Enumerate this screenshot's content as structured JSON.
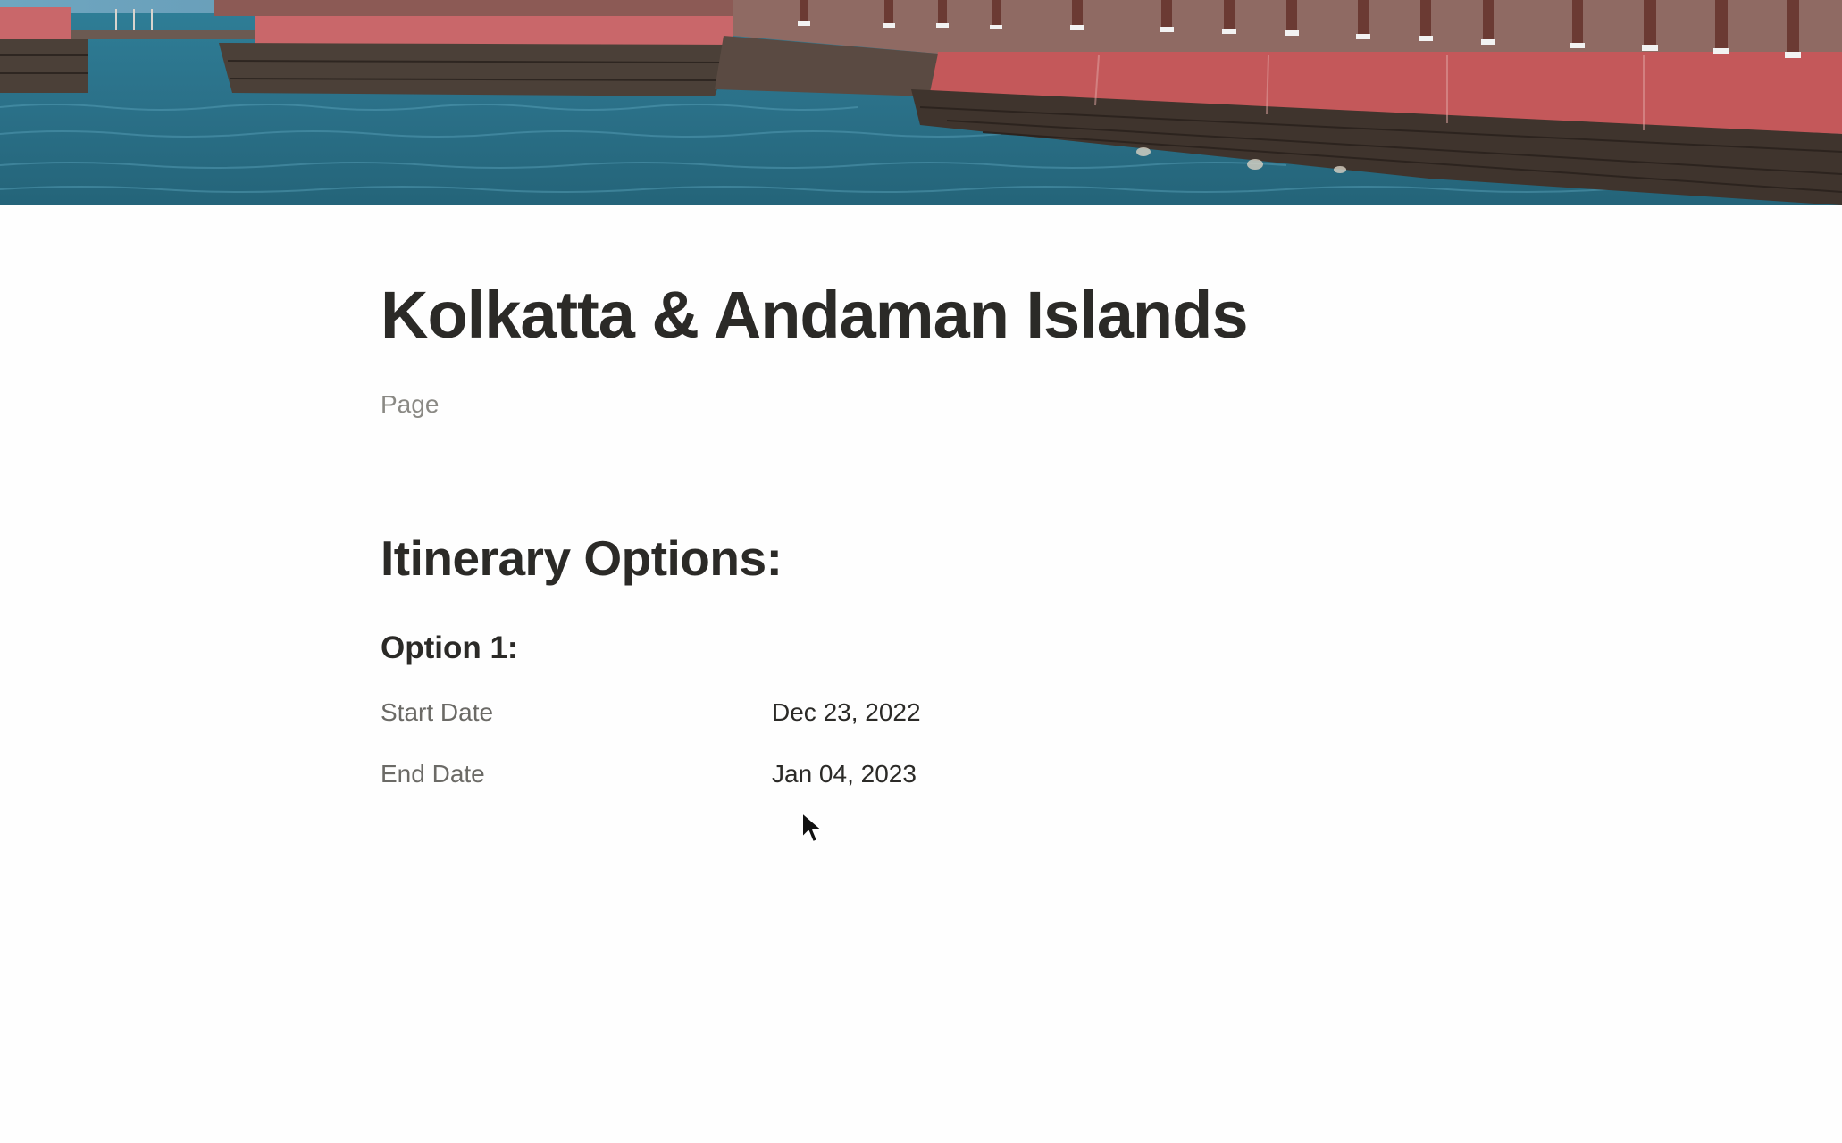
{
  "cover": {
    "image_name": "harbor-jetty-photo"
  },
  "page": {
    "title": "Kolkatta & Andaman Islands",
    "property_label": "Page"
  },
  "body": {
    "heading": "Itinerary Options:",
    "option": {
      "heading": "Option 1:",
      "properties": [
        {
          "label": "Start Date",
          "value": "Dec 23, 2022"
        },
        {
          "label": "End Date",
          "value": "Jan 04, 2023"
        }
      ]
    }
  },
  "colors": {
    "background": "#fefefe",
    "title_text": "#2b2a27",
    "muted_text": "#8a8984",
    "property_label_text": "#6b6a66",
    "water": "#2c7d96",
    "pier_red": "#c4585a",
    "stone": "#4a3f37"
  }
}
